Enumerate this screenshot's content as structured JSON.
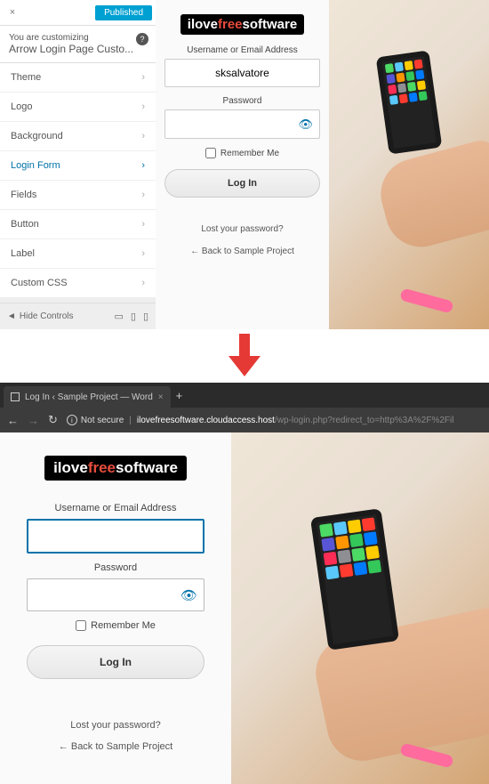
{
  "top": {
    "customizer": {
      "close": "×",
      "publish": "Published",
      "subtitle": "You are customizing",
      "title": "Arrow Login Page Custo...",
      "help": "?",
      "menu": [
        "Theme",
        "Logo",
        "Background",
        "Login Form",
        "Fields",
        "Button",
        "Label",
        "Custom CSS"
      ],
      "active_index": 3,
      "hide_controls": "Hide Controls"
    },
    "login": {
      "logo_prefix": "ilove",
      "logo_mid": "free",
      "logo_suffix": "software",
      "username_label": "Username or Email Address",
      "username_value": "sksalvatore",
      "password_label": "Password",
      "remember": "Remember Me",
      "login_btn": "Log In",
      "lost_password": "Lost your password?",
      "back_link": "← Back to Sample Project"
    }
  },
  "bottom": {
    "tab_title": "Log In ‹ Sample Project — Word",
    "not_secure": "Not secure",
    "url_host": "ilovefreesoftware.cloudaccess.host",
    "url_path": "/wp-login.php?redirect_to=http%3A%2F%2Fil",
    "login": {
      "logo_prefix": "ilove",
      "logo_mid": "free",
      "logo_suffix": "software",
      "username_label": "Username or Email Address",
      "username_value": "",
      "password_label": "Password",
      "remember": "Remember Me",
      "login_btn": "Log In",
      "lost_password": "Lost your password?",
      "back_link": "← Back to Sample Project"
    }
  },
  "app_colors": [
    "#4cd964",
    "#5ac8fa",
    "#ffcc00",
    "#ff3b30",
    "#5856d6",
    "#ff9500",
    "#34c759",
    "#007aff",
    "#ff2d55",
    "#8e8e93",
    "#4cd964",
    "#ffcc00",
    "#5ac8fa",
    "#ff3b30",
    "#007aff",
    "#34c759"
  ]
}
